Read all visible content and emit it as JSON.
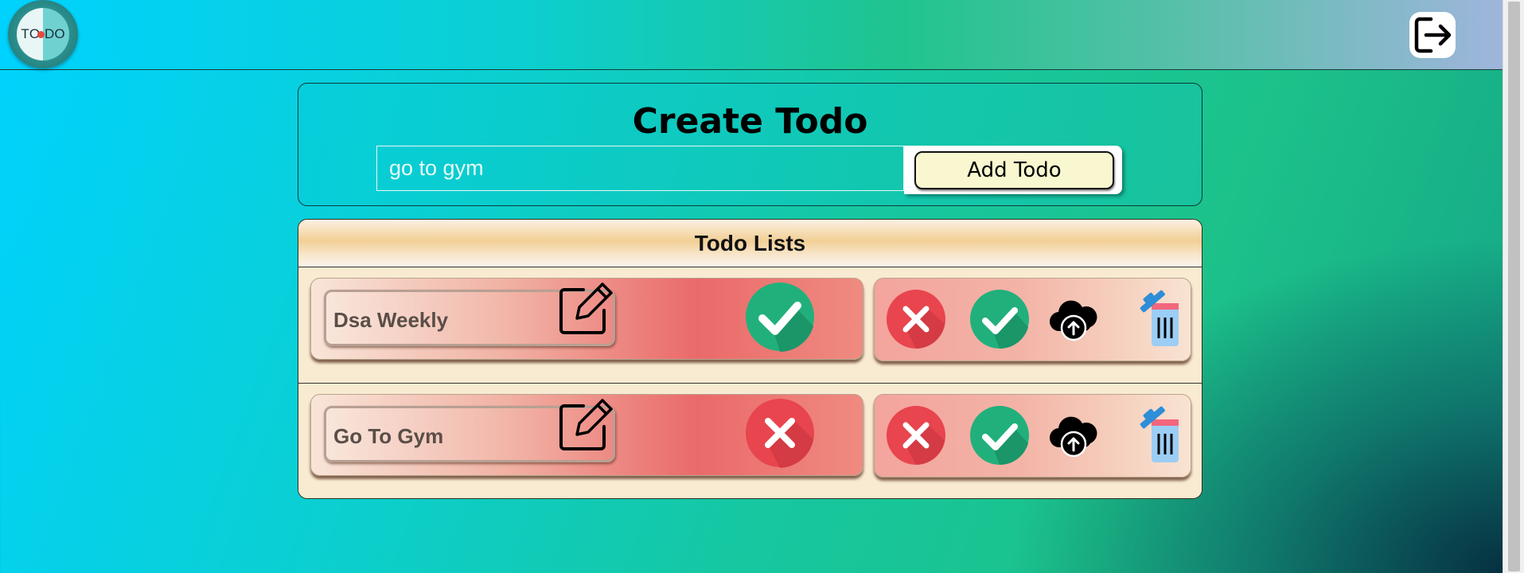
{
  "header": {
    "logo_text_left": "T",
    "logo_text_right": "O",
    "logo_text_middle": "D",
    "logout_icon": "logout-icon"
  },
  "create": {
    "title": "Create Todo",
    "input_value": "go to gym",
    "add_label": "Add Todo"
  },
  "list": {
    "title": "Todo Lists",
    "items": [
      {
        "title": "Dsa Weekly",
        "status": "completed",
        "status_icon": "check-circle-icon"
      },
      {
        "title": "Go To Gym",
        "status": "not-completed",
        "status_icon": "x-circle-icon"
      }
    ],
    "actions": [
      "x-circle-icon",
      "check-circle-icon",
      "cloud-upload-icon",
      "trash-icon"
    ]
  },
  "colors": {
    "check_green": "#21b07c",
    "x_red": "#e8454e",
    "accent_yellow": "#f8f7cf"
  }
}
